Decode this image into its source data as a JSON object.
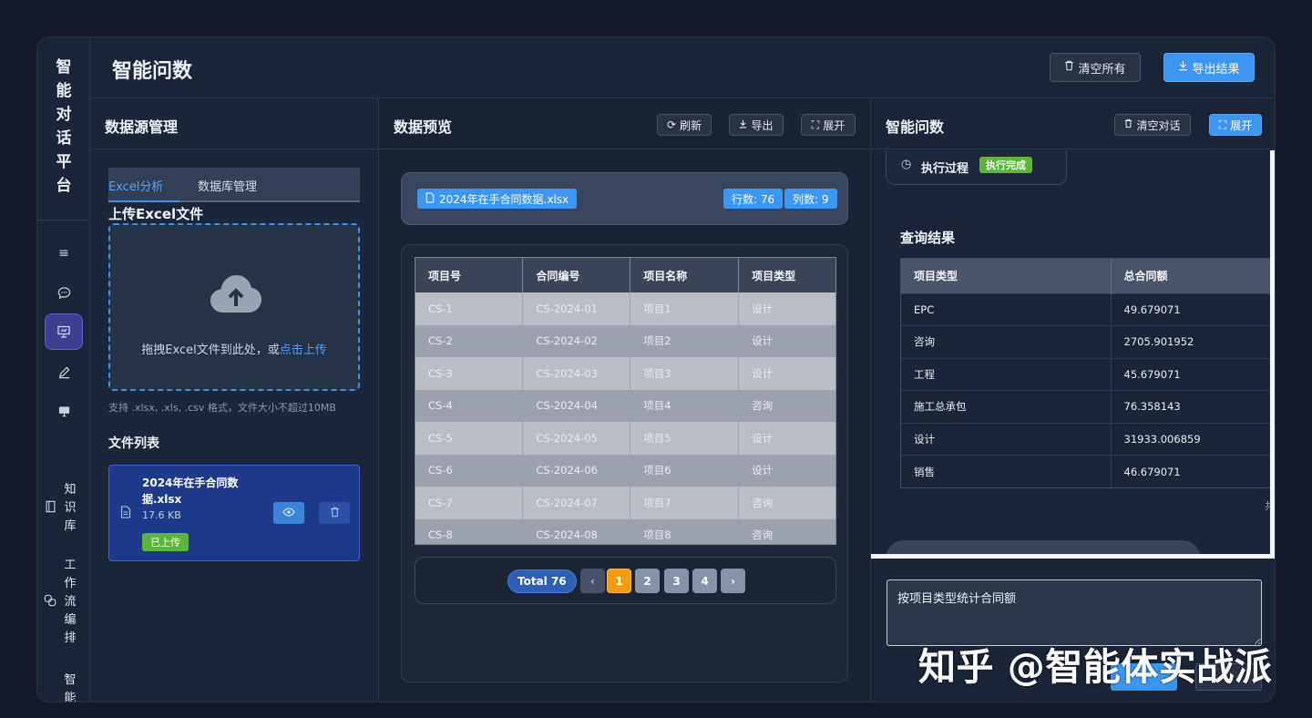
{
  "brand": {
    "chars": [
      "智",
      "能",
      "对",
      "话",
      "平",
      "台"
    ]
  },
  "rail": {
    "icons": [
      "menu-icon",
      "chat-icon",
      "presentation-icon",
      "pen-icon",
      "desktop-icon"
    ],
    "knowledge": {
      "icon": "book-icon",
      "chars": [
        "知",
        "识",
        "库"
      ]
    },
    "workflow": {
      "icon": "link-icon",
      "chars": [
        "工",
        "作",
        "流",
        "编",
        "排"
      ]
    },
    "smart": {
      "chars": [
        "智",
        "能"
      ]
    }
  },
  "header": {
    "title": "智能问数",
    "clear_all": "清空所有",
    "export_result": "导出结果"
  },
  "datasource": {
    "title": "数据源管理",
    "tabs": [
      "Excel分析",
      "数据库管理"
    ],
    "upload_title": "上传Excel文件",
    "drop_text": "拖拽Excel文件到此处，或",
    "drop_link": "点击上传",
    "hint": "支持 .xlsx, .xls, .csv 格式，文件大小不超过10MB",
    "filelist_title": "文件列表",
    "file": {
      "name": "2024年在手合同数据.xlsx",
      "size": "17.6 KB",
      "status": "已上传"
    }
  },
  "preview": {
    "title": "数据预览",
    "refresh": "刷新",
    "export": "导出",
    "expand": "展开",
    "file_chip": "2024年在手合同数据.xlsx",
    "rows_chip": "行数: 76",
    "cols_chip": "列数: 9",
    "columns": [
      "项目号",
      "合同编号",
      "项目名称",
      "项目类型"
    ],
    "rows": [
      [
        "CS-1",
        "CS-2024-01",
        "项目1",
        "设计"
      ],
      [
        "CS-2",
        "CS-2024-02",
        "项目2",
        "设计"
      ],
      [
        "CS-3",
        "CS-2024-03",
        "项目3",
        "设计"
      ],
      [
        "CS-4",
        "CS-2024-04",
        "项目4",
        "咨询"
      ],
      [
        "CS-5",
        "CS-2024-05",
        "项目5",
        "设计"
      ],
      [
        "CS-6",
        "CS-2024-06",
        "项目6",
        "设计"
      ],
      [
        "CS-7",
        "CS-2024-07",
        "项目7",
        "咨询"
      ],
      [
        "CS-8",
        "CS-2024-08",
        "项目8",
        "咨询"
      ]
    ],
    "total": "Total 76",
    "pages": [
      "1",
      "2",
      "3",
      "4"
    ],
    "current_page": "1"
  },
  "qa": {
    "title": "智能问数",
    "clear_chat": "清空对话",
    "expand": "展开",
    "process_label": "执行过程",
    "process_status": "执行完成",
    "result_title": "查询结果",
    "columns": [
      "项目类型",
      "总合同额"
    ],
    "rows": [
      [
        "EPC",
        "49.679071"
      ],
      [
        "咨询",
        "2705.901952"
      ],
      [
        "工程",
        "45.679071"
      ],
      [
        "施工总承包",
        "76.358143"
      ],
      [
        "设计",
        "31933.006859"
      ],
      [
        "销售",
        "46.679071"
      ]
    ],
    "more": "共",
    "input_value": "按项目类型统计合同额"
  },
  "watermark": "知乎 @智能体实战派",
  "colors": {
    "accent": "#3d97f2",
    "success": "#5ab53a",
    "page_current": "#f39c12",
    "nav_active": "#3d3f8f"
  }
}
